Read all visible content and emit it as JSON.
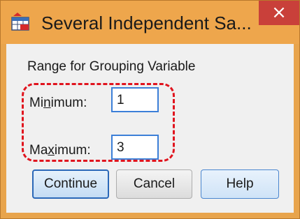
{
  "window": {
    "title": "Several Independent Sa...",
    "close_glyph": "×",
    "app_icon": "spss-dialog-icon"
  },
  "dialog": {
    "group_label": "Range for Grouping Variable",
    "minimum": {
      "label_before": "Mi",
      "mnemonic": "n",
      "label_after": "imum:",
      "value": "1"
    },
    "maximum": {
      "label_before": "Ma",
      "mnemonic": "x",
      "label_after": "imum:",
      "value": "3"
    }
  },
  "buttons": {
    "continue_label": "Continue",
    "cancel_label": "Cancel",
    "help_label": "Help"
  },
  "colors": {
    "title_bar": "#eea64c",
    "close_button": "#c9403a",
    "highlight_dash": "#e0141e",
    "focus_border": "#3c7fd8"
  }
}
